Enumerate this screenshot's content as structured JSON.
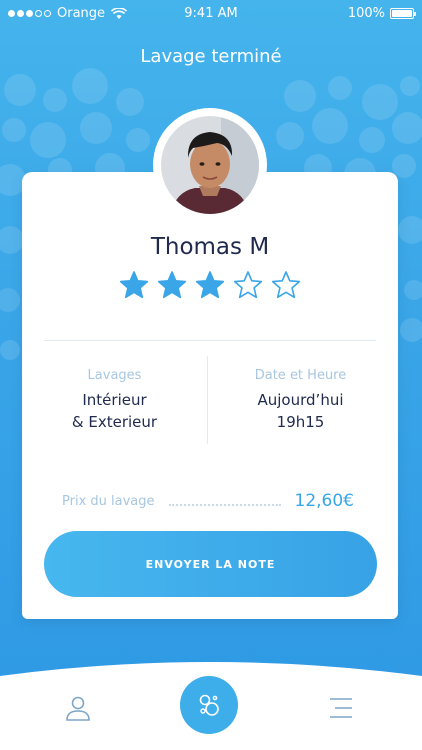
{
  "status_bar": {
    "carrier": "Orange",
    "time": "9:41 AM",
    "battery": "100%"
  },
  "header": {
    "title": "Lavage terminé"
  },
  "profile": {
    "name": "Thomas M",
    "rating": 3,
    "max_rating": 5
  },
  "details": {
    "wash": {
      "label": "Lavages",
      "value_line1": "Intérieur",
      "value_line2": "& Exterieur"
    },
    "datetime": {
      "label": "Date et Heure",
      "value_line1": "Aujourd’hui",
      "value_line2": "19h15"
    }
  },
  "price": {
    "label": "Prix du lavage",
    "value": "12,60€"
  },
  "actions": {
    "send_label": "ENVOYER LA NOTE"
  },
  "tab_bar": {
    "items": [
      {
        "icon": "user-icon"
      },
      {
        "icon": "bubbles-icon"
      },
      {
        "icon": "menu-icon"
      }
    ]
  },
  "colors": {
    "accent": "#3aa6e8",
    "text_dark": "#1f2a4d",
    "muted": "#a8c6df"
  }
}
